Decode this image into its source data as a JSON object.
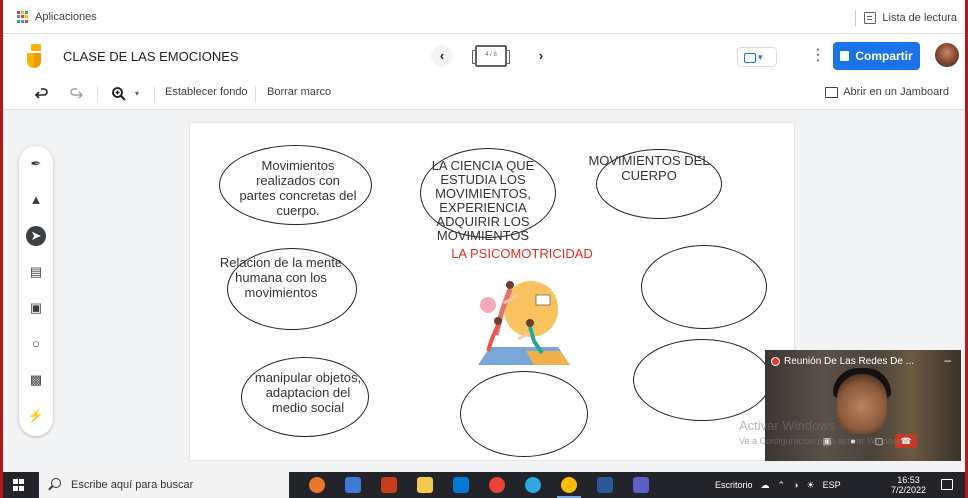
{
  "bookmarks": {
    "apps_label": "Aplicaciones",
    "reading_list_label": "Lista de lectura"
  },
  "header": {
    "title": "CLASE DE LAS EMOCIONES",
    "frame_indicator": "4 / 6",
    "share_label": "Compartir"
  },
  "toolbar": {
    "set_background_label": "Establecer fondo",
    "clear_frame_label": "Borrar marco",
    "open_in_jamboard_label": "Abrir en un Jamboard"
  },
  "board": {
    "notes": [
      "Movimientos",
      "realizados con",
      "partes concretas del",
      "cuerpo.",
      "LA CIENCIA QUE",
      "ESTUDIA LOS",
      "MOVIMIENTOS,",
      "EXPERIENCIA",
      "ADQUIRIR LOS",
      "MOVIMIENTOS",
      "MOVIMIENTOS DEL",
      "CUERPO",
      "Relacion de la mente",
      "humana con los",
      "movimientos",
      "manipular objetos,",
      "adaptacion del",
      "medio social"
    ],
    "center_title": "LA PSICOMOTRICIDAD"
  },
  "video": {
    "title": "Reunión De Las Redes De ...",
    "watermark_line1": "Activar Windows",
    "watermark_line2": "Ve a Configuración para activar Windows."
  },
  "taskbar": {
    "search_placeholder": "Escribe aquí para buscar",
    "desktop_label": "Escritorio",
    "language": "ESP",
    "time": "16:53",
    "date": "7/2/2022"
  },
  "colors": {
    "accent": "#1a73e8",
    "logo_yellow": "#f4b400",
    "title_red": "#d93025",
    "taskbar": "#23232a",
    "window_border": "#b01a1a"
  },
  "icons": {
    "apps": "apps-grid-icon",
    "reading_list": "reading-list-icon",
    "prev": "chevron-left-icon",
    "next": "chevron-right-icon",
    "more": "more-vert-icon",
    "undo": "undo-icon",
    "redo": "redo-icon",
    "zoom": "zoom-in-icon",
    "open_jamboard": "jamboard-open-icon"
  }
}
